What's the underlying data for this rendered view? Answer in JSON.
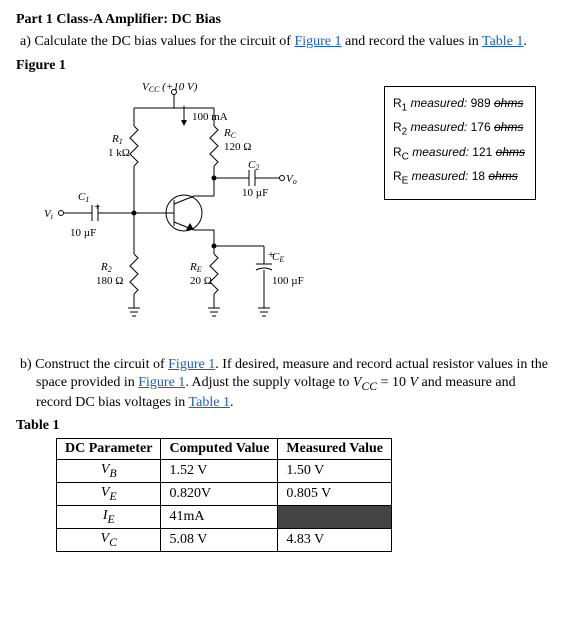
{
  "part_title": "Part 1 Class-A Amplifier: DC Bias",
  "q_a": {
    "prefix": "a)  Calculate the DC bias values for the circuit of ",
    "link1": "Figure 1",
    "mid": " and record the values in ",
    "link2": "Table 1",
    "suffix": "."
  },
  "figure_label": "Figure 1",
  "circuit": {
    "vcc": "V_CC (+10 V)",
    "i_arrow": "100 mA",
    "rc_name": "R_C",
    "rc_val": "120 Ω",
    "r1_name": "R_1",
    "r1_val": "1 kΩ",
    "c2_name": "C_2",
    "c2_val": "10 µF",
    "vo": "V_o",
    "c1_name": "C_1",
    "c1_val": "10 µF",
    "vi": "V_i",
    "r2_name": "R_2",
    "r2_val": "180 Ω",
    "re_name": "R_E",
    "re_val": "20 Ω",
    "ce_name": "C_E",
    "ce_val": "100 µF"
  },
  "measured": {
    "r1_label": "R_1 measured:",
    "r1_val": "989",
    "r2_label": "R_2 measured:",
    "r2_val": "176",
    "rc_label": "R_C measured:",
    "rc_val": "121",
    "re_label": "R_E measured:",
    "re_val": "18",
    "unit": "ohms"
  },
  "q_b": {
    "prefix": "b)  Construct the circuit of ",
    "link1": "Figure 1",
    "mid1": ". If desired, measure and record actual resistor values in the space provided in ",
    "link2": "Figure 1",
    "mid2": ". Adjust the supply voltage to ",
    "vcc_eq": "V_CC = 10 V",
    "mid3": " and measure and record DC bias voltages in ",
    "link3": "Table 1",
    "suffix": "."
  },
  "table_label": "Table 1",
  "table": {
    "headers": [
      "DC Parameter",
      "Computed Value",
      "Measured Value"
    ],
    "rows": [
      {
        "param": "V_B",
        "computed": "1.52 V",
        "measured": "1.50 V",
        "shaded": false
      },
      {
        "param": "V_E",
        "computed": "0.820V",
        "measured": "0.805 V",
        "shaded": false
      },
      {
        "param": "I_E",
        "computed": "41mA",
        "measured": "",
        "shaded": true
      },
      {
        "param": "V_C",
        "computed": "5.08 V",
        "measured": "4.83 V",
        "shaded": false
      }
    ]
  }
}
